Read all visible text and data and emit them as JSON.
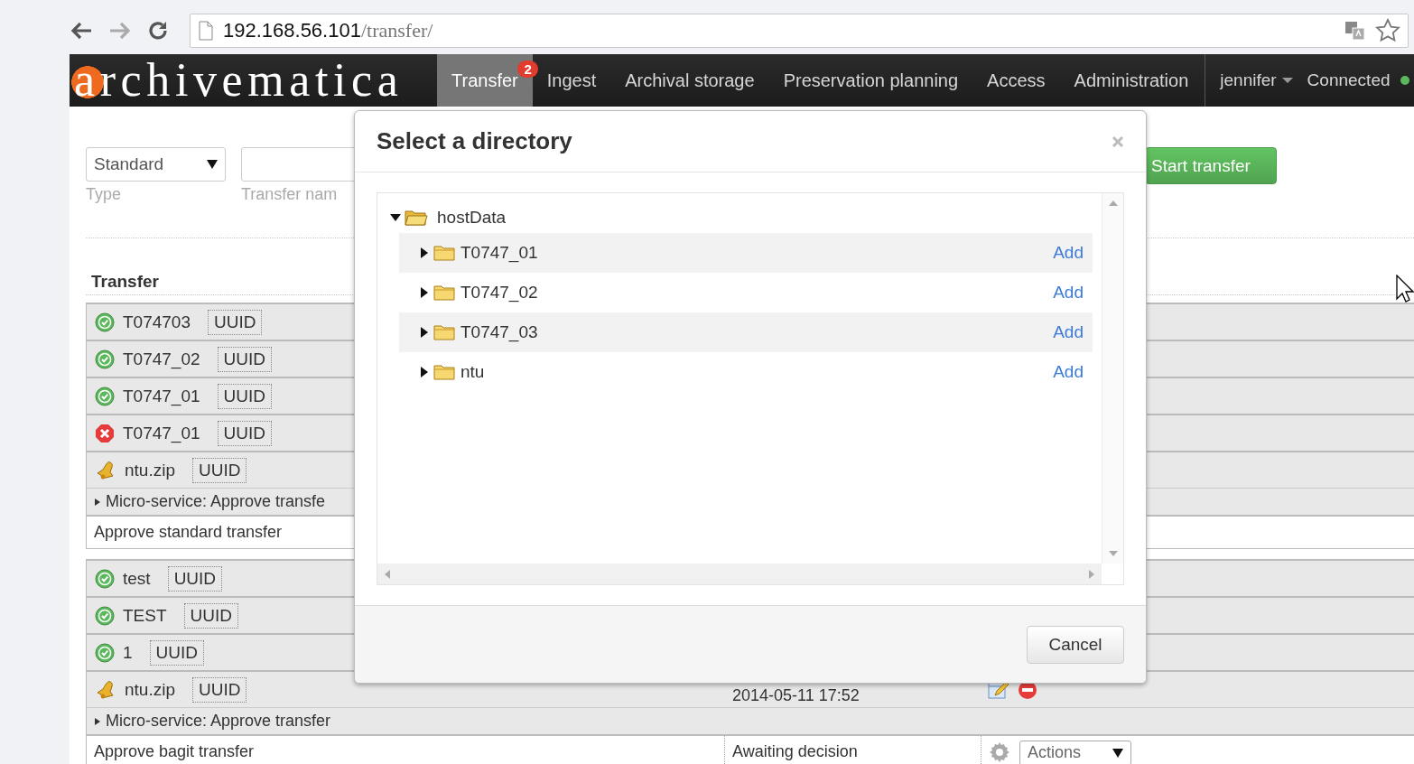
{
  "browser": {
    "url_host": "192.168.56.101",
    "url_path": "/transfer/"
  },
  "navbar": {
    "logo": "archivematica",
    "tabs": [
      {
        "label": "Transfer",
        "selected": true,
        "badge": "2"
      },
      {
        "label": "Ingest",
        "selected": false
      },
      {
        "label": "Archival storage",
        "selected": false
      },
      {
        "label": "Preservation planning",
        "selected": false
      },
      {
        "label": "Access",
        "selected": false
      },
      {
        "label": "Administration",
        "selected": false
      }
    ],
    "user": "jennifer",
    "status": "Connected"
  },
  "form": {
    "type_value": "Standard",
    "type_label": "Type",
    "name_label": "Transfer nam",
    "start_button": "Start transfer"
  },
  "transfers": {
    "heading": "Transfer",
    "groups": [
      {
        "rows": [
          {
            "name": "T074703",
            "kind": "done",
            "uuid": "UUID"
          },
          {
            "name": "T0747_02",
            "kind": "done",
            "uuid": "UUID"
          },
          {
            "name": "T0747_01",
            "kind": "done",
            "uuid": "UUID"
          },
          {
            "name": "T0747_01",
            "kind": "failed",
            "uuid": "UUID"
          },
          {
            "name": "ntu.zip",
            "kind": "awaiting",
            "uuid": "UUID"
          }
        ],
        "microservice": "Micro-service: Approve transfe",
        "job": "Approve standard transfer"
      },
      {
        "rows": [
          {
            "name": "test",
            "kind": "done",
            "uuid": "UUID"
          },
          {
            "name": "TEST",
            "kind": "done",
            "uuid": "UUID"
          },
          {
            "name": "1",
            "kind": "done",
            "uuid": "UUID"
          },
          {
            "name": "ntu.zip",
            "kind": "awaiting",
            "uuid": "UUID",
            "date": "2014-05-11 17:52"
          }
        ],
        "microservice": "Micro-service: Approve transfer",
        "job": "Approve bagit transfer",
        "job_status": "Awaiting decision",
        "actions": "Actions"
      }
    ]
  },
  "dialog": {
    "title": "Select a directory",
    "tree": {
      "label": "hostData",
      "expanded": true,
      "children": [
        {
          "label": "T0747_01",
          "expanded": false,
          "action": "Add"
        },
        {
          "label": "T0747_02",
          "expanded": false,
          "action": "Add"
        },
        {
          "label": "T0747_03",
          "expanded": false,
          "action": "Add"
        },
        {
          "label": "ntu",
          "expanded": false,
          "action": "Add"
        }
      ]
    },
    "cancel": "Cancel"
  }
}
